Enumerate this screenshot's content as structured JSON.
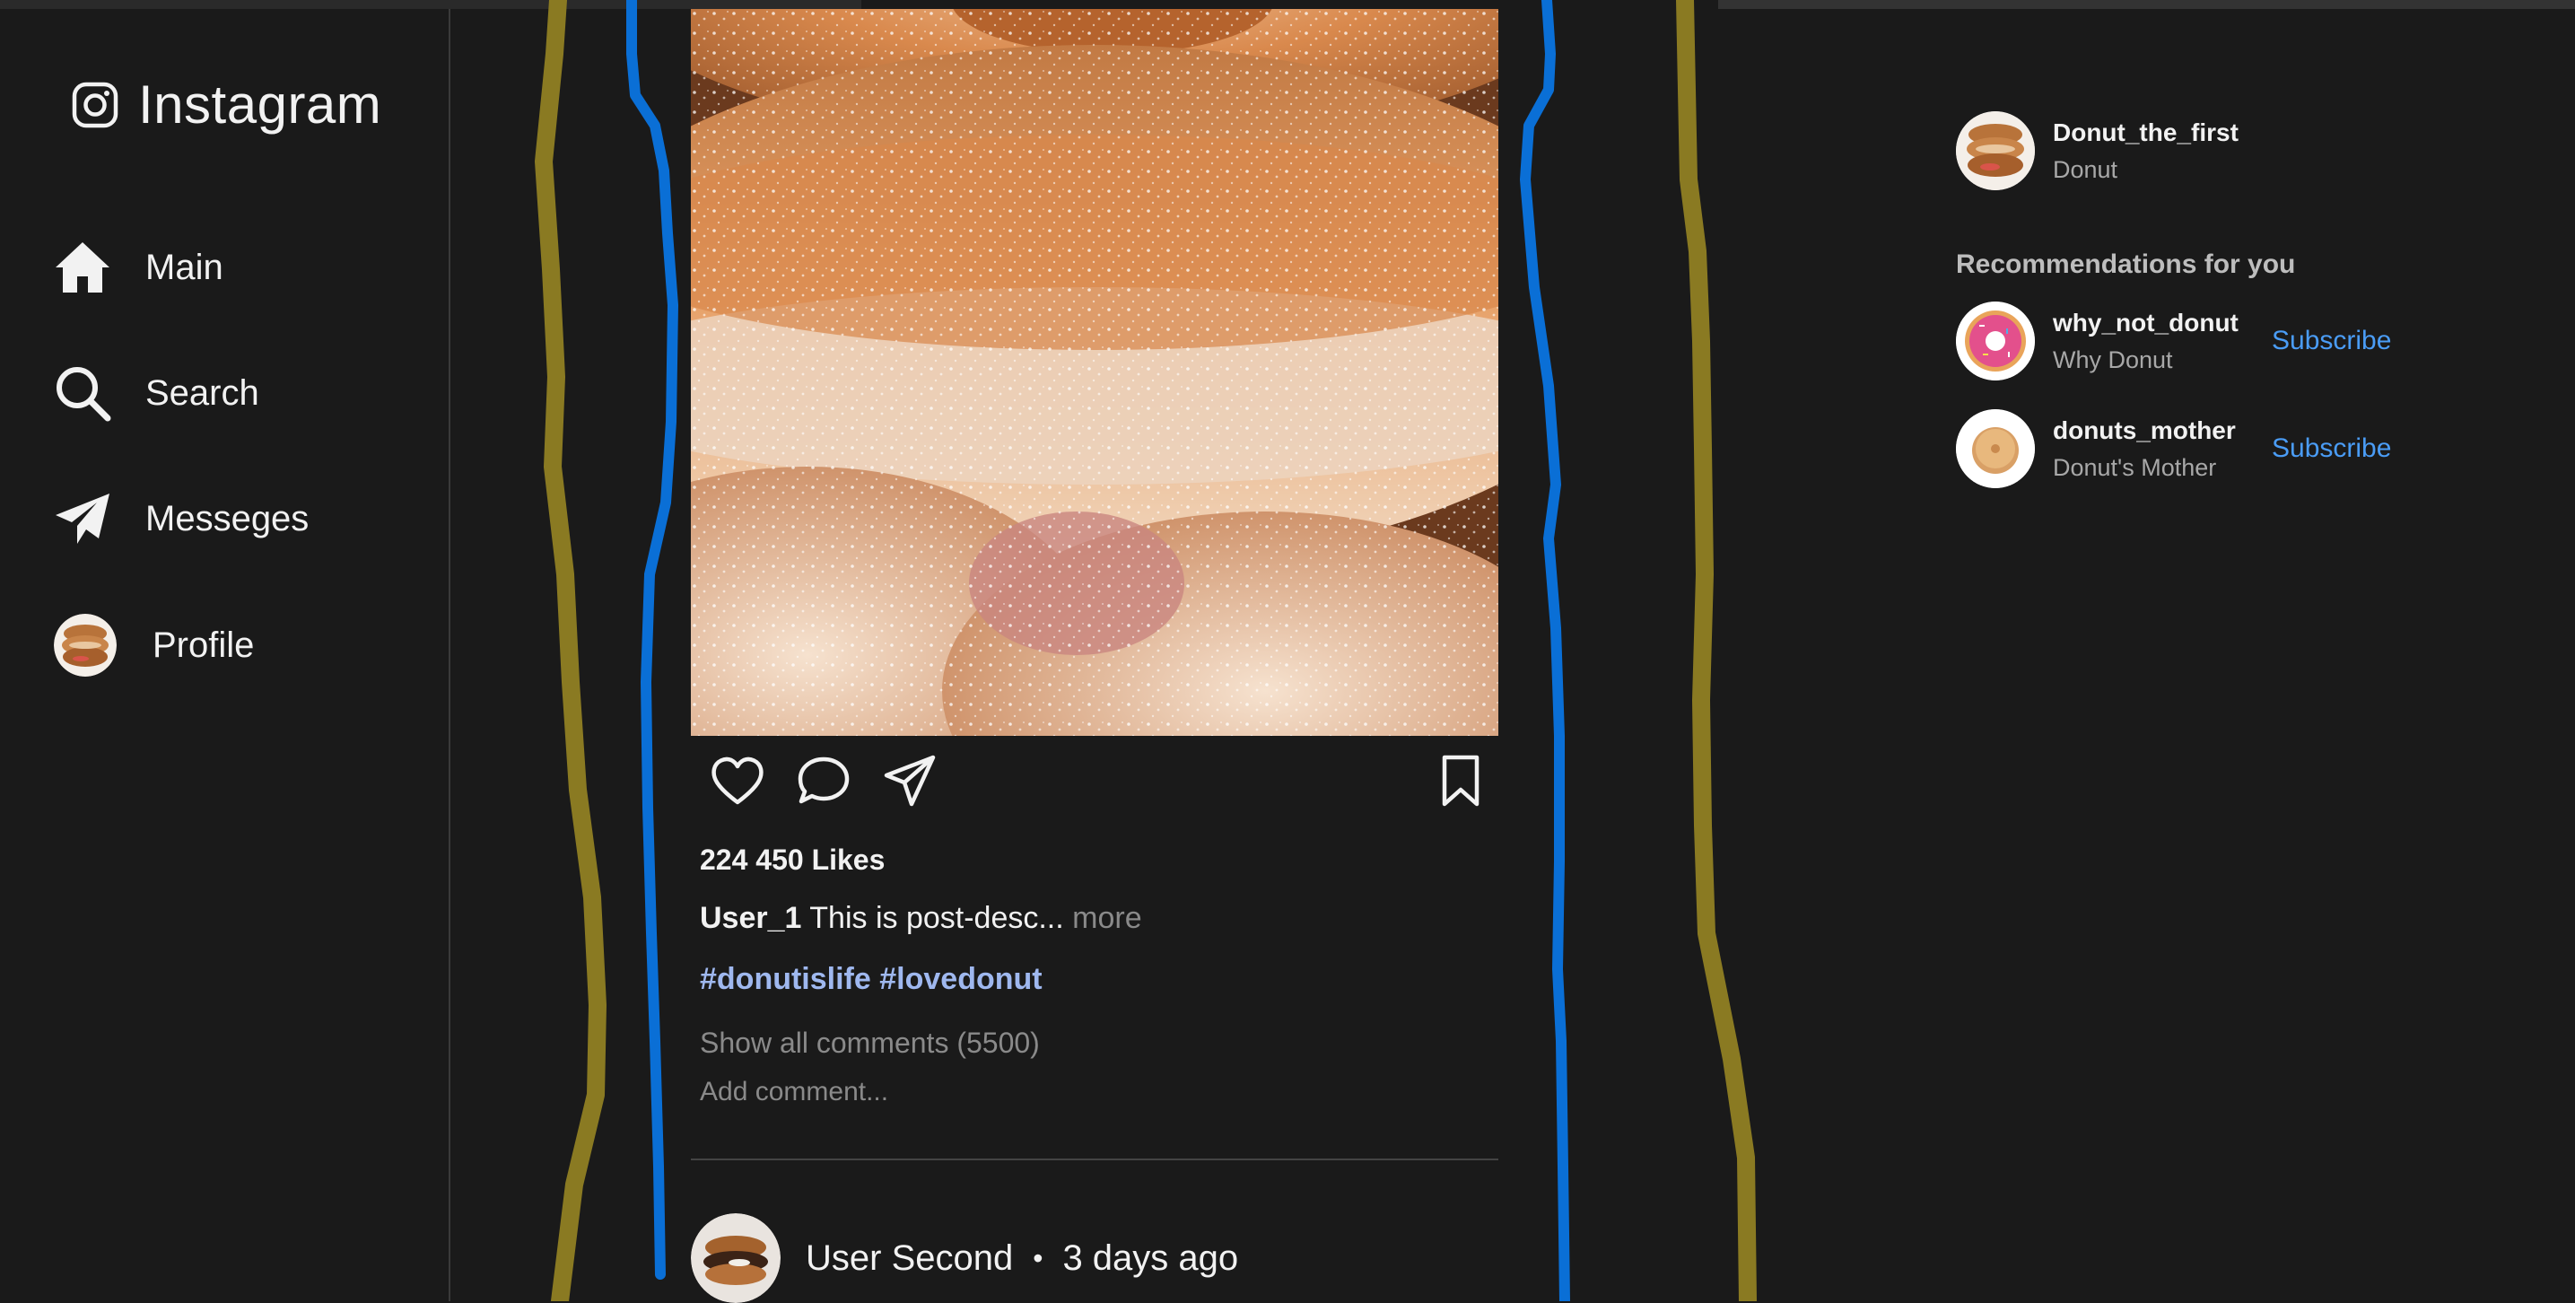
{
  "app": {
    "name": "Instagram"
  },
  "nav": {
    "items": [
      {
        "label": "Main",
        "icon": "home-icon"
      },
      {
        "label": "Search",
        "icon": "search-icon"
      },
      {
        "label": "Messeges",
        "icon": "send-icon"
      },
      {
        "label": "Profile",
        "icon": "avatar"
      }
    ]
  },
  "post": {
    "likes": "224 450 Likes",
    "author": "User_1",
    "description": "This is post-desc...",
    "more_label": "more",
    "hashtags": [
      "#donutislife",
      "#lovedonut"
    ],
    "show_comments": "Show all comments (5500)",
    "add_comment_placeholder": "Add comment..."
  },
  "next_post": {
    "user": "User Second",
    "separator": "•",
    "time": "3 days ago"
  },
  "current_user": {
    "username": "Donut_the_first",
    "display_name": "Donut"
  },
  "recommendations": {
    "title": "Recommendations for you",
    "items": [
      {
        "username": "why_not_donut",
        "display_name": "Why Donut",
        "action": "Subscribe"
      },
      {
        "username": "donuts_mother",
        "display_name": "Donut's Mother",
        "action": "Subscribe"
      }
    ]
  },
  "colors": {
    "background": "#1a1a1a",
    "link": "#4a9cf5",
    "hashtag": "#9fb8ef",
    "annotation_blue": "#0a6fd6",
    "annotation_olive": "#8a7a22"
  }
}
